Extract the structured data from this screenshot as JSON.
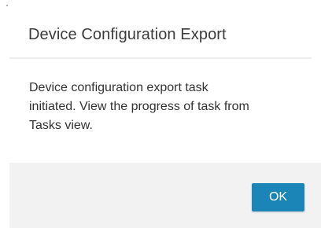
{
  "dialog": {
    "title": "Device Configuration Export",
    "message": "Device configuration export task initiated. View the progress of task from Tasks view.",
    "ok_label": "OK"
  },
  "colors": {
    "primary_button": "#1b85b8",
    "footer_background": "#f2f2f2",
    "title_text": "#3b3b3b",
    "body_text": "#333333"
  }
}
